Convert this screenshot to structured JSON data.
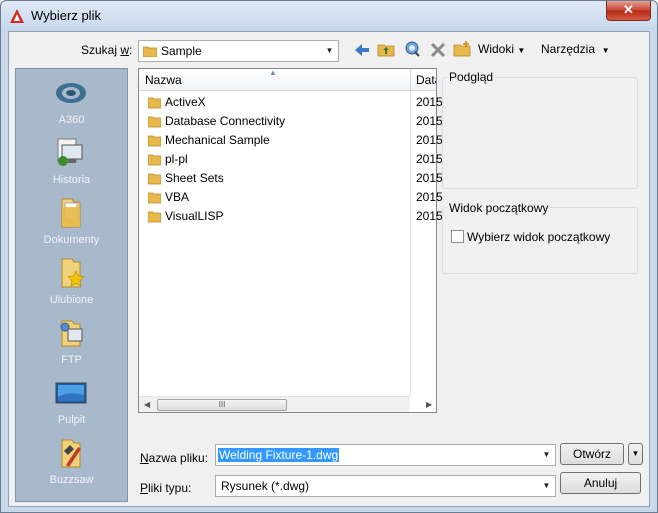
{
  "window": {
    "title": "Wybierz plik",
    "close_label": "✕"
  },
  "lookin": {
    "label_prefix": "Szukaj ",
    "label_key": "w",
    "label_suffix": ":",
    "value": "Sample"
  },
  "toolbar": {
    "views_label": "Widoki",
    "tools_label": "Narzędzia"
  },
  "places": [
    {
      "label": "A360",
      "icon": "cloud-icon"
    },
    {
      "label": "Historia",
      "icon": "history-icon"
    },
    {
      "label": "Dokumenty",
      "icon": "documents-folder-icon"
    },
    {
      "label": "Ulubione",
      "icon": "favorites-folder-icon"
    },
    {
      "label": "FTP",
      "icon": "ftp-icon"
    },
    {
      "label": "Pulpit",
      "icon": "desktop-icon"
    },
    {
      "label": "Buzzsaw",
      "icon": "buzzsaw-icon"
    }
  ],
  "filelist": {
    "columns": {
      "name": "Nazwa",
      "date": "Data"
    },
    "rows": [
      {
        "name": "ActiveX",
        "date": "2015"
      },
      {
        "name": "Database Connectivity",
        "date": "2015"
      },
      {
        "name": "Mechanical Sample",
        "date": "2015"
      },
      {
        "name": "pl-pl",
        "date": "2015"
      },
      {
        "name": "Sheet Sets",
        "date": "2015"
      },
      {
        "name": "VBA",
        "date": "2015"
      },
      {
        "name": "VisualLISP",
        "date": "2015"
      }
    ],
    "hscroll_thumb": "III"
  },
  "preview": {
    "title": "Podgląd"
  },
  "initial_view": {
    "title": "Widok początkowy",
    "checkbox_label": "Wybierz widok początkowy",
    "checked": false
  },
  "filename": {
    "label_key": "N",
    "label_rest": "azwa pliku:",
    "value": "Welding Fixture-1.dwg"
  },
  "filetype": {
    "label_key": "P",
    "label_rest": "liki typu:",
    "value": "Rysunek (*.dwg)"
  },
  "buttons": {
    "open": "Otwórz",
    "cancel": "Anuluj"
  },
  "colors": {
    "accent": "#3399ff",
    "places_bg": "#a9b9cc",
    "close_red": "#c74331"
  }
}
